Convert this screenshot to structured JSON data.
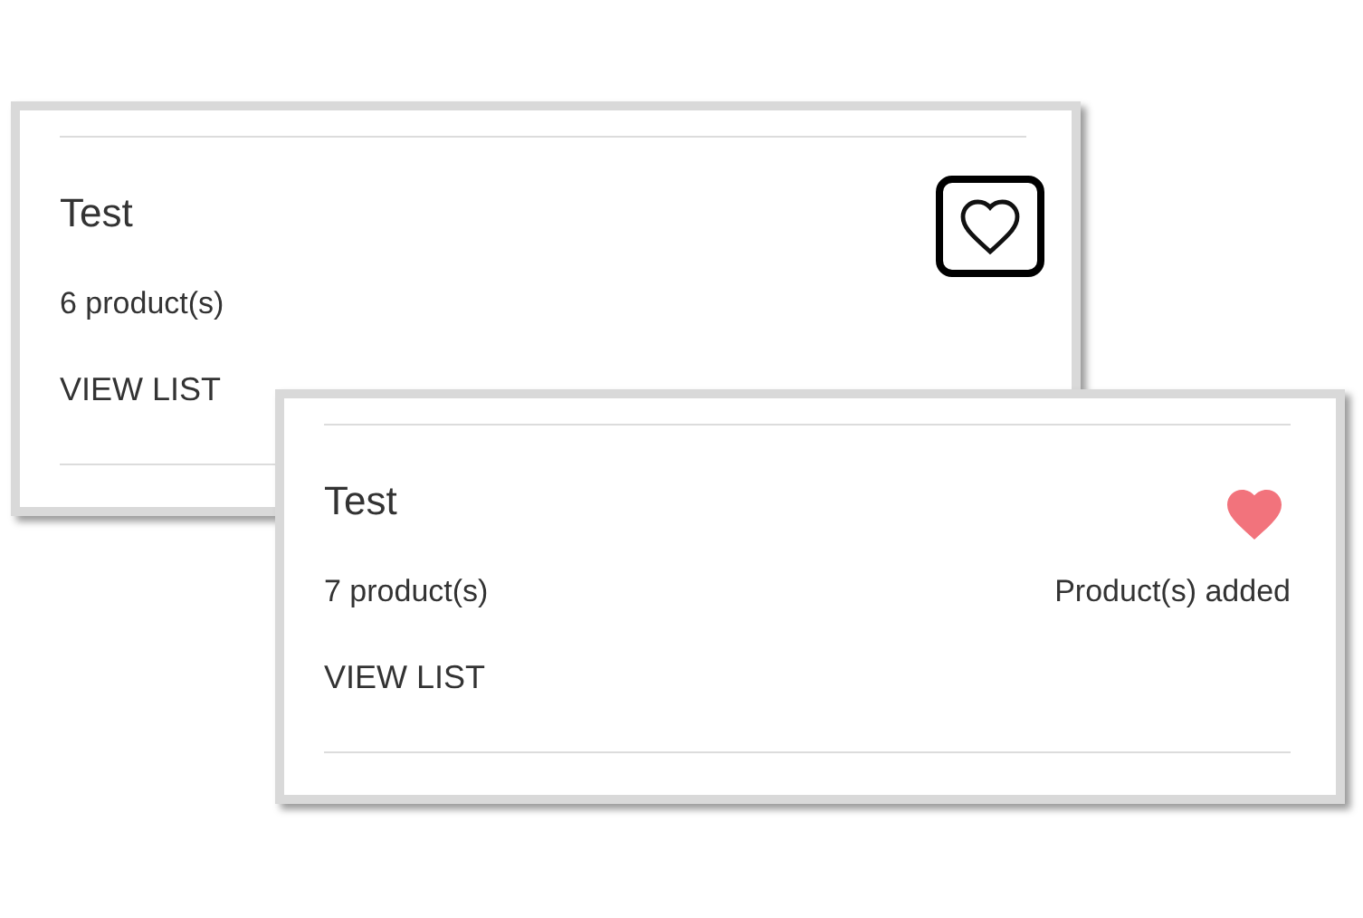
{
  "cards": [
    {
      "title": "Test",
      "count": "6 product(s)",
      "action": "VIEW LIST",
      "favorited": false,
      "focused": true
    },
    {
      "title": "Test",
      "count": "7 product(s)",
      "status": "Product(s) added",
      "action": "VIEW LIST",
      "favorited": true,
      "focused": false
    }
  ]
}
